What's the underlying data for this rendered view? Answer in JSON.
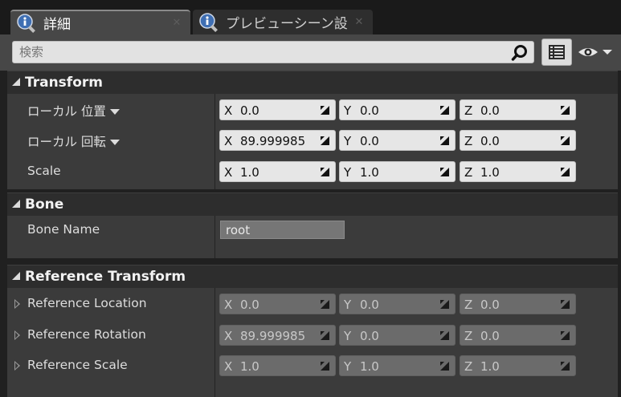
{
  "tabs": [
    {
      "label": "詳細",
      "close": "✕",
      "icon": "details-info-icon"
    },
    {
      "label": "プレビューシーン設",
      "close": "✕",
      "icon": "details-info-icon"
    }
  ],
  "search": {
    "placeholder": "検索"
  },
  "sections": {
    "transform": {
      "title": "Transform",
      "rows": [
        {
          "label": "ローカル 位置",
          "x": "0.0",
          "y": "0.0",
          "z": "0.0"
        },
        {
          "label": "ローカル 回転",
          "x": "89.999985",
          "y": "0.0",
          "z": "0.0"
        },
        {
          "label": "Scale",
          "x": "1.0",
          "y": "1.0",
          "z": "1.0"
        }
      ]
    },
    "bone": {
      "title": "Bone",
      "label": "Bone Name",
      "value": "root"
    },
    "reference": {
      "title": "Reference Transform",
      "rows": [
        {
          "label": "Reference Location",
          "x": "0.0",
          "y": "0.0",
          "z": "0.0"
        },
        {
          "label": "Reference Rotation",
          "x": "89.999985",
          "y": "0.0",
          "z": "0.0"
        },
        {
          "label": "Reference Scale",
          "x": "1.0",
          "y": "1.0",
          "z": "1.0"
        }
      ]
    }
  },
  "axis_labels": {
    "x": "X",
    "y": "Y",
    "z": "Z"
  },
  "colors": {
    "panel": "#3b3b3b",
    "header": "#2d2d2d",
    "field": "#e6e6e6",
    "field_disabled": "#6b6b6b"
  }
}
